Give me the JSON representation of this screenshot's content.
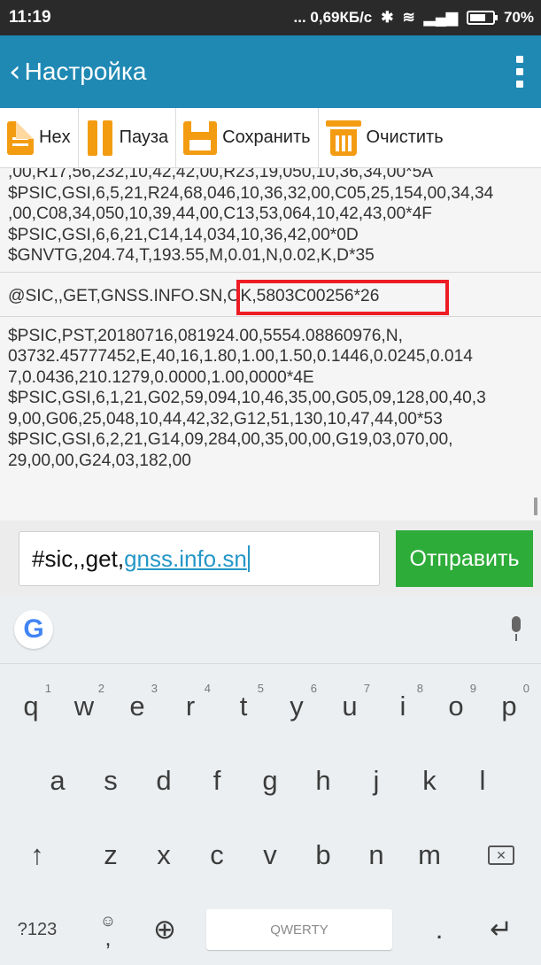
{
  "status_bar": {
    "time": "11:19",
    "speed": "... 0,69КБ/с",
    "battery_percent": "70%",
    "battery_level": 0.7
  },
  "app_bar": {
    "title": "Настройка",
    "back_icon": "chevron-left-icon",
    "menu_icon": "more-vert-icon"
  },
  "toolbar": {
    "hex_label": "Hex",
    "pause_label": "Пауза",
    "save_label": "Сохранить",
    "clear_label": "Очистить",
    "accent_color": "#f39c12"
  },
  "log": {
    "block1": [
      ",00,R17,56,232,10,42,42,00,R23,19,050,10,36,34,00*5A",
      "$PSIC,GSI,6,5,21,R24,68,046,10,36,32,00,C05,25,154,00,34,34",
      ",00,C08,34,050,10,39,44,00,C13,53,064,10,42,43,00*4F",
      "$PSIC,GSI,6,6,21,C14,14,034,10,36,42,00*0D",
      "$GNVTG,204.74,T,193.55,M,0.01,N,0.02,K,D*35"
    ],
    "response": "@SIC,,GET,GNSS.INFO.SN,OK,5803C00256*26",
    "block3": [
      "$PSIC,PST,20180716,081924.00,5554.08860976,N,",
      "03732.45777452,E,40,16,1.80,1.00,1.50,0.1446,0.0245,0.014",
      "7,0.0436,210.1279,0.0000,1.00,0000*4E",
      "$PSIC,GSI,6,1,21,G02,59,094,10,46,35,00,G05,09,128,00,40,3",
      "9,00,G06,25,048,10,44,42,32,G12,51,130,10,47,44,00*53",
      "$PSIC,GSI,6,2,21,G14,09,284,00,35,00,00,G19,03,070,00,",
      "29,00,00,G24,03,182,00"
    ],
    "highlight_color": "#ee1c24"
  },
  "command": {
    "prefix": "#sic,,get,",
    "underlined": "gnss.info.sn",
    "send_label": "Отправить",
    "send_color": "#2eac3a"
  },
  "keyboard": {
    "row1": [
      {
        "k": "q",
        "h": "1"
      },
      {
        "k": "w",
        "h": "2"
      },
      {
        "k": "e",
        "h": "3"
      },
      {
        "k": "r",
        "h": "4"
      },
      {
        "k": "t",
        "h": "5"
      },
      {
        "k": "y",
        "h": "6"
      },
      {
        "k": "u",
        "h": "7"
      },
      {
        "k": "i",
        "h": "8"
      },
      {
        "k": "o",
        "h": "9"
      },
      {
        "k": "p",
        "h": "0"
      }
    ],
    "row2": [
      "a",
      "s",
      "d",
      "f",
      "g",
      "h",
      "j",
      "k",
      "l"
    ],
    "row3": [
      "z",
      "x",
      "c",
      "v",
      "b",
      "n",
      "m"
    ],
    "num_label": "?123",
    "comma": ",",
    "period": ".",
    "space_label": "QWERTY",
    "google_letter": "G"
  }
}
